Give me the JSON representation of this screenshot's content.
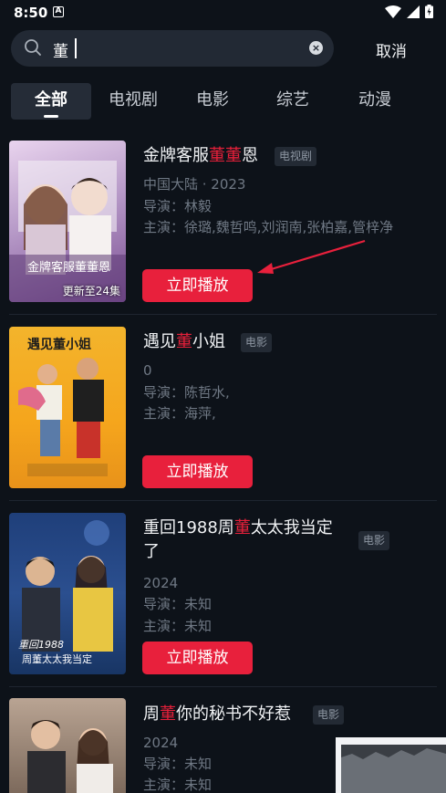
{
  "status_bar": {
    "time": "8:50",
    "a_icon": "A"
  },
  "search": {
    "query": "董"
  },
  "cancel_label": "取消",
  "tabs": [
    {
      "label": "全部"
    },
    {
      "label": "电视剧"
    },
    {
      "label": "电影"
    },
    {
      "label": "综艺"
    },
    {
      "label": "动漫"
    }
  ],
  "results": [
    {
      "title_pre": "金牌客服",
      "title_hl": "董董",
      "title_post": "恩",
      "type_badge": "电视剧",
      "info": "中国大陆 · 2023",
      "director": "导演：林毅",
      "cast": "主演：徐璐,魏哲鸣,刘润南,张柏嘉,管梓净",
      "poster_caption": "更新至24集",
      "play_label": "立即播放"
    },
    {
      "title_pre": "遇见",
      "title_hl": "董",
      "title_post": "小姐",
      "type_badge": "电影",
      "info": "0",
      "director": "导演：陈哲水,",
      "cast": "主演：海萍,",
      "play_label": "立即播放"
    },
    {
      "title_pre": "重回1988周",
      "title_hl": "董",
      "title_post": "太太我当定",
      "title_line2": "了",
      "type_badge": "电影",
      "info": "2024",
      "director": "导演：未知",
      "cast": "主演：未知",
      "play_label": "立即播放"
    },
    {
      "title_pre": "周",
      "title_hl": "董",
      "title_post": "你的秘书不好惹",
      "type_badge": "电影",
      "info": "2024",
      "director": "导演：未知",
      "cast": "主演：未知"
    }
  ],
  "colors": {
    "accent": "#e8203c",
    "highlight": "#e6203a",
    "background": "#0d1219"
  }
}
